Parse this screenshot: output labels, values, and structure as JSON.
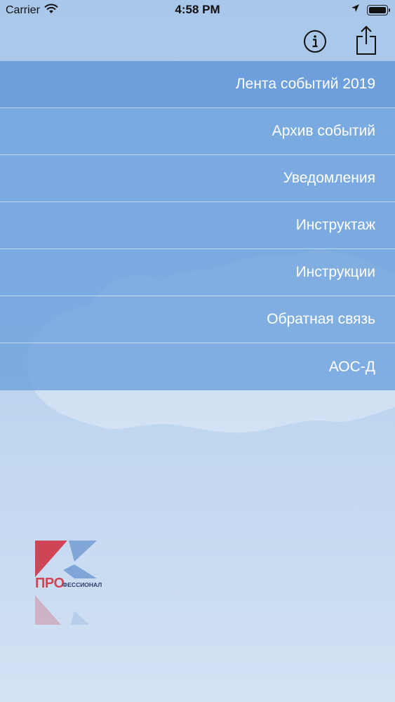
{
  "status_bar": {
    "carrier": "Carrier",
    "time": "4:58 PM",
    "icons": [
      "wifi-icon",
      "location-arrow-icon",
      "battery-icon"
    ]
  },
  "nav_bar": {
    "icons": [
      "info-icon",
      "share-icon"
    ]
  },
  "menu": {
    "items": [
      {
        "label": "Лента событий 2019"
      },
      {
        "label": "Архив событий"
      },
      {
        "label": "Уведомления"
      },
      {
        "label": "Инструктаж"
      },
      {
        "label": "Инструкции"
      },
      {
        "label": "Обратная связь"
      },
      {
        "label": "АОС-Д"
      }
    ]
  },
  "logo": {
    "pro": "ПРО",
    "rest": "ФЕССИОНАЛ"
  },
  "colors": {
    "menu_bg": "#6aa0dc",
    "logo_red": "#d04556",
    "logo_blue": "#7fa6d6",
    "logo_dark": "#2a3f6a"
  }
}
